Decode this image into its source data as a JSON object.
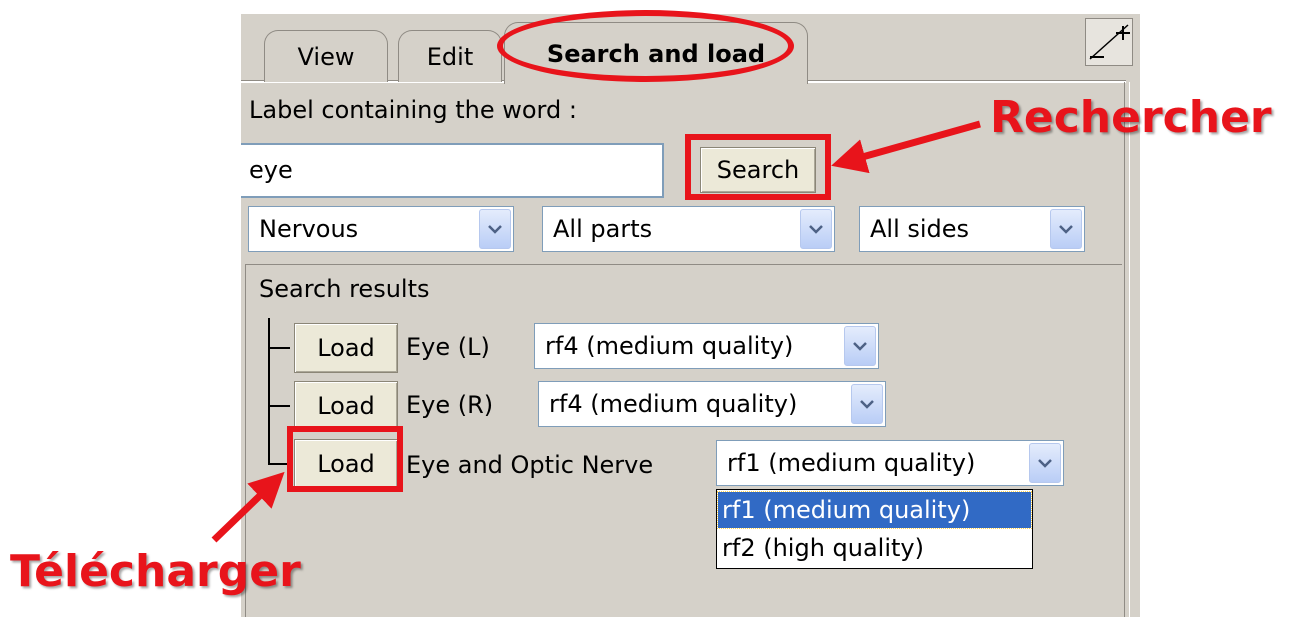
{
  "tabs": [
    {
      "label": "View"
    },
    {
      "label": "Edit"
    },
    {
      "label": "Search and load",
      "active": true
    }
  ],
  "search": {
    "label": "Label containing the word :",
    "value": "eye",
    "button_label": "Search"
  },
  "filters": {
    "system": "Nervous",
    "parts": "All parts",
    "sides": "All sides"
  },
  "results": {
    "title": "Search results",
    "load_label": "Load",
    "items": [
      {
        "name": "Eye (L)",
        "quality": "rf4 (medium quality)"
      },
      {
        "name": "Eye (R)",
        "quality": "rf4 (medium quality)"
      },
      {
        "name": "Eye and Optic Nerve",
        "quality": "rf1 (medium quality)"
      }
    ],
    "open_dropdown_options": [
      "rf1 (medium quality)",
      "rf2 (high quality)"
    ],
    "open_dropdown_selected": "rf1 (medium quality)"
  },
  "annotations": {
    "search_callout": "Rechercher",
    "load_callout": "Télécharger",
    "color": "#e8141b"
  }
}
